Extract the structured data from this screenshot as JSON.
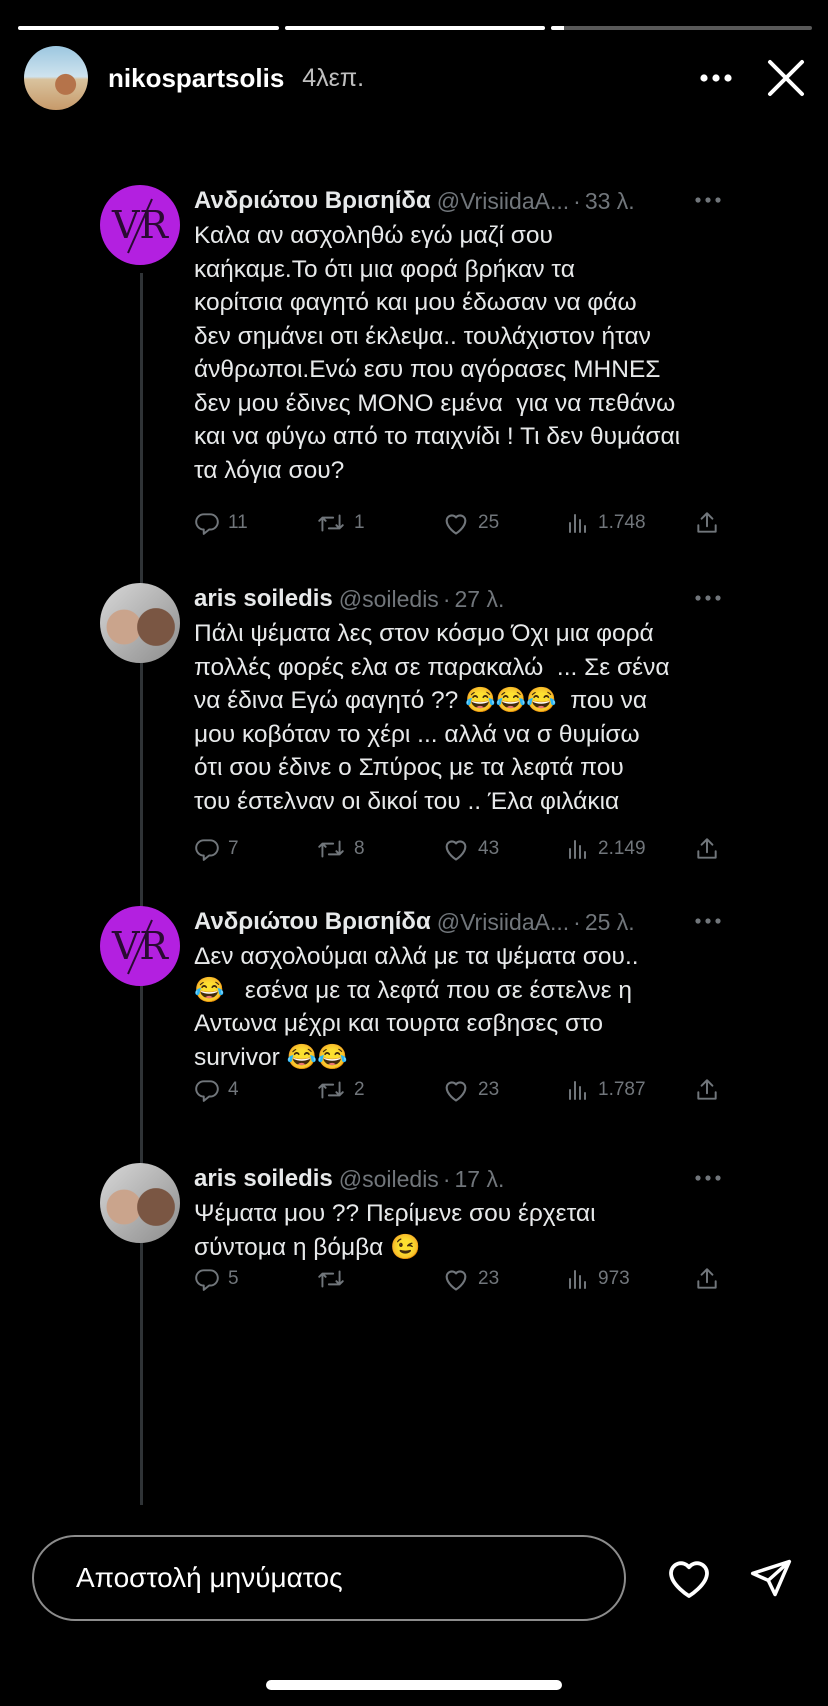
{
  "story": {
    "progress": [
      1,
      1,
      0.05
    ],
    "username": "nikospartsolis",
    "time": "4λεπ."
  },
  "tweets": [
    {
      "name": "Ανδριώτου Βρισηίδα",
      "handle": "@VrisiidaA...",
      "time": "33 λ.",
      "avatar_text": "VR",
      "text": "Καλα αν ασχοληθώ εγώ μαζί σου\nκαήκαμε.Το ότι μια φορά βρήκαν τα\nκορίτσια φαγητό και μου έδωσαν να φάω\nδεν σημάνει οτι έκλεψα.. τουλάχιστον ήταν\nάνθρωποι.Ενώ εσυ που αγόρασες ΜΗΝΕΣ\nδεν μου έδινες ΜΟΝΟ εμένα  για να πεθάνω\nκαι να φύγω από το παιχνίδι ! Τι δεν θυμάσαι\nτα λόγια σου?",
      "replies": "11",
      "retweets": "1",
      "likes": "25",
      "views": "1.748"
    },
    {
      "name": "aris soiledis",
      "handle": "@soiledis",
      "time": "27 λ.",
      "text": "Πάλι ψέματα λες στον κόσμο Όχι μια φορά\nπολλές φορές ελα σε παρακαλώ  ... Σε σένα\nνα έδινα Εγώ φαγητό ?? 😂😂😂  που να\nμου κοβόταν το χέρι ... αλλά να σ θυμίσω\nότι σου έδινε ο Σπύρος με τα λεφτά που\nτου έστελναν οι δικοί του .. Έλα φιλάκια",
      "replies": "7",
      "retweets": "8",
      "likes": "43",
      "views": "2.149"
    },
    {
      "name": "Ανδριώτου Βρισηίδα",
      "handle": "@VrisiidaA...",
      "time": "25 λ.",
      "avatar_text": "VR",
      "text": "Δεν ασχολούμαι αλλά με τα ψέματα σου..\n😂   εσένα με τα λεφτά που σε έστελνε η\nΑντωνα μέχρι και τουρτα εσβησες στο\nsurvivor 😂😂",
      "replies": "4",
      "retweets": "2",
      "likes": "23",
      "views": "1.787"
    },
    {
      "name": "aris soiledis",
      "handle": "@soiledis",
      "time": "17 λ.",
      "text": "Ψέματα μου ?? Περίμενε σου έρχεται\nσύντομα η βόμβα 😉",
      "replies": "5",
      "retweets": "",
      "likes": "23",
      "views": "973"
    }
  ],
  "reply": {
    "placeholder": "Αποστολή μηνύματος"
  },
  "colors": {
    "background": "#000000",
    "text": "#e7e9ea",
    "muted": "#71767b",
    "vr_purple": "#b320e0"
  }
}
